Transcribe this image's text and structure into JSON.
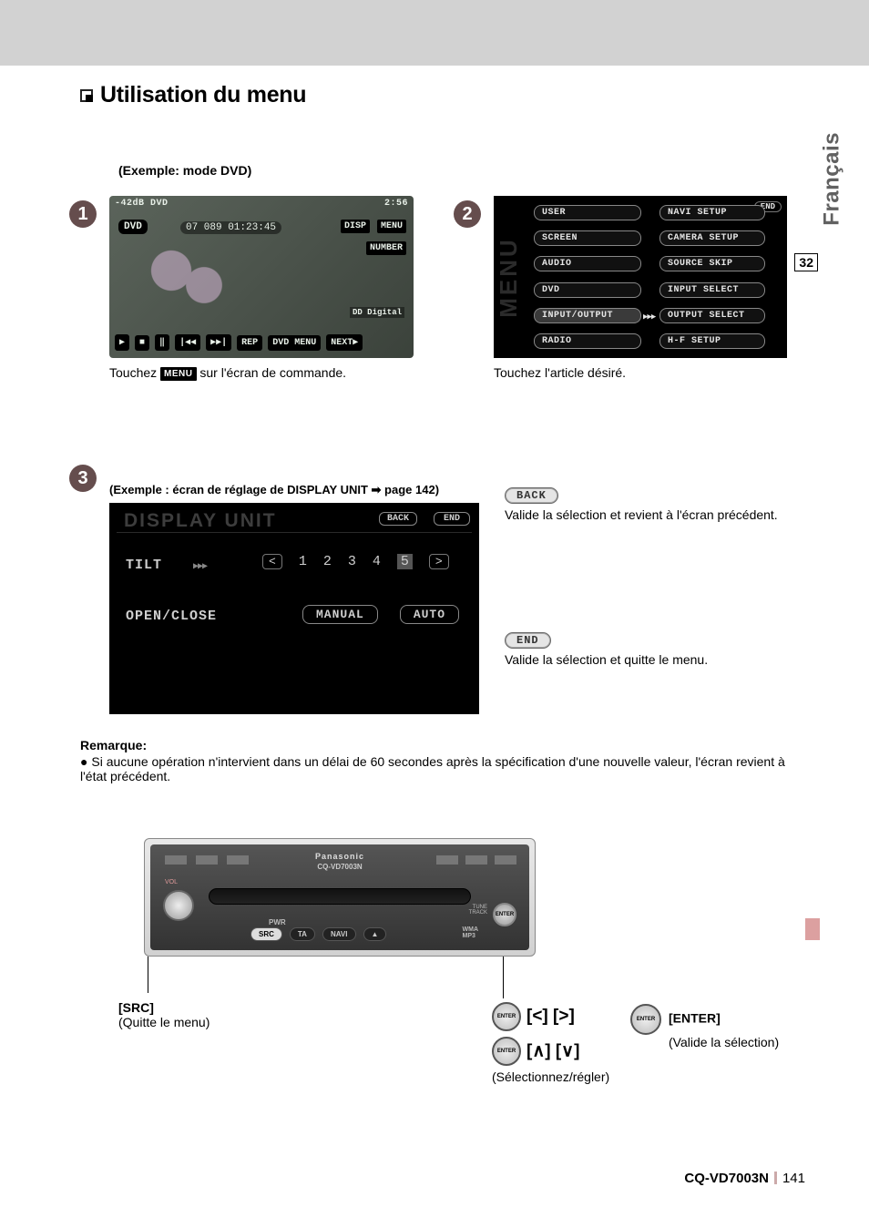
{
  "heading": "Utilisation du menu",
  "language_tab": "Français",
  "side_page_ref": "32",
  "steps": {
    "s1": "1",
    "s2": "2",
    "s3": "3"
  },
  "step1": {
    "example_label": "(Exemple: mode DVD)",
    "topbar_left": "-42dB  DVD",
    "topbar_right": "2:56",
    "dvd_label": "DVD",
    "counter": "07   089  01:23:45",
    "btn_disp": "DISP",
    "btn_menu": "MENU",
    "btn_number": "NUMBER",
    "dd": "DD Digital",
    "play_bar": [
      "▶",
      "■",
      "‖",
      "|◀◀",
      "▶▶|",
      "REP",
      "DVD MENU",
      "NEXT▶"
    ],
    "caption_pre": "Touchez ",
    "caption_btn": "MENU",
    "caption_post": " sur l'écran de commande."
  },
  "step2": {
    "end": "END",
    "col1": [
      "USER",
      "SCREEN",
      "AUDIO",
      "DVD",
      "INPUT/OUTPUT",
      "RADIO"
    ],
    "col2": [
      "NAVI SETUP",
      "CAMERA SETUP",
      "SOURCE SKIP",
      "INPUT SELECT",
      "OUTPUT SELECT",
      "H-F SETUP"
    ],
    "selected_index": 4,
    "menu_word": "MENU",
    "arrow": "▶▶▶",
    "caption": "Touchez l'article désiré."
  },
  "step3": {
    "caption_top": "(Exemple : écran de réglage de DISPLAY UNIT ➡ page 142)",
    "title": "DISPLAY UNIT",
    "back": "BACK",
    "end": "END",
    "tilt_label": "TILT",
    "tilt_arrow": "▶▶▶",
    "numbers": [
      "1",
      "2",
      "3",
      "4",
      "5"
    ],
    "selected_number": "5",
    "open_close": "OPEN/CLOSE",
    "manual": "MANUAL",
    "auto": "AUTO"
  },
  "right": {
    "back_label": "BACK",
    "back_desc": "Valide la sélection et revient à l'écran précédent.",
    "end_label": "END",
    "end_desc": "Valide la sélection et quitte le menu."
  },
  "remarque": {
    "heading": "Remarque:",
    "item": "Si aucune opération n'intervient dans un délai de 60 secondes après la spécification d'une nouvelle valeur, l'écran revient à l'état précédent."
  },
  "panel": {
    "brand": "Panasonic",
    "model": "CQ-VD7003N",
    "vol": "VOL",
    "pwr": "PWR",
    "buttons": [
      "SRC",
      "TA",
      "NAVI",
      "▲"
    ],
    "tune": "TUNE\nTRACK",
    "enter": "ENTER",
    "wma": "WMA\nMP3"
  },
  "labels": {
    "src_title": "[SRC]",
    "src_sub": "(Quitte le menu)",
    "lr": "[<] [>]",
    "ud": "[∧] [∨]",
    "select": "(Sélectionnez/régler)",
    "enter_title": "[ENTER]",
    "enter_sub": "(Valide la sélection)"
  },
  "footer": {
    "model": "CQ-VD7003N",
    "page": "141"
  }
}
